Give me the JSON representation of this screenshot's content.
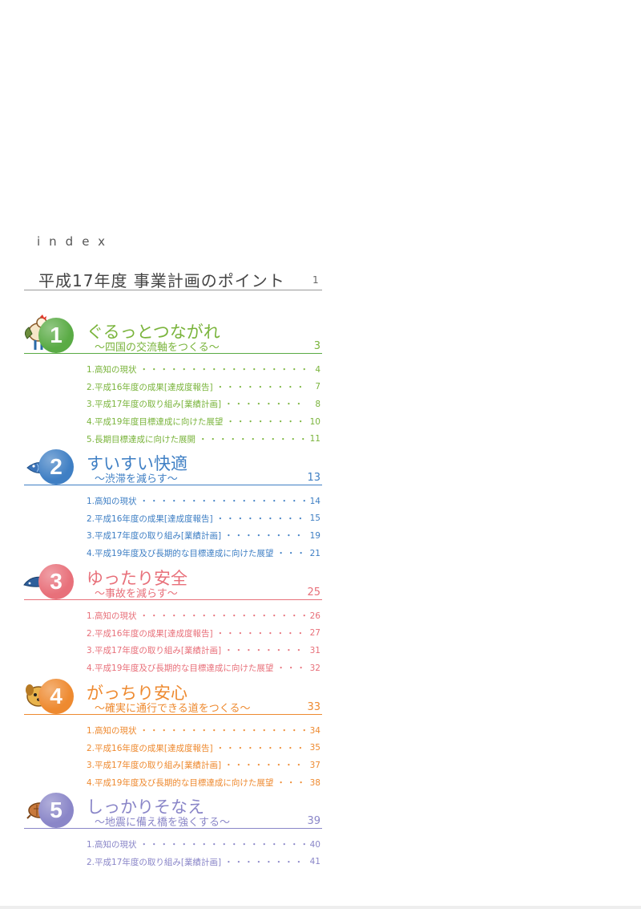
{
  "index_label": "index",
  "main": {
    "title": "平成17年度 事業計画のポイント",
    "page": "1"
  },
  "dots": "・・・・・・・・・・・・・・・・・・・・・・・・・・・・・・・・・・・・・・・・・・・・",
  "sections": [
    {
      "number": "1",
      "title": "ぐるっとつながれ",
      "subtitle": "〜四国の交流軸をつくる〜",
      "page": "3",
      "color": "#5aab45",
      "text_color": "#7ab43c",
      "items": [
        {
          "label": "1.高知の現状",
          "page": "4"
        },
        {
          "label": "2.平成16年度の成果[達成度報告]",
          "page": "7"
        },
        {
          "label": "3.平成17年度の取り組み[業績計画]",
          "page": "8"
        },
        {
          "label": "4.平成19年度目標達成に向けた展望",
          "page": "10"
        },
        {
          "label": "5.長期目標達成に向けた展開",
          "page": "11"
        }
      ]
    },
    {
      "number": "2",
      "title": "すいすい快適",
      "subtitle": "〜渋滞を減らす〜",
      "page": "13",
      "color": "#3f7fc4",
      "text_color": "#3f7fc4",
      "items": [
        {
          "label": "1.高知の現状",
          "page": "14"
        },
        {
          "label": "2.平成16年度の成果[達成度報告]",
          "page": "15"
        },
        {
          "label": "3.平成17年度の取り組み[業績計画]",
          "page": "19"
        },
        {
          "label": "4.平成19年度及び長期的な目標達成に向けた展望",
          "page": "21"
        }
      ]
    },
    {
      "number": "3",
      "title": "ゆったり安全",
      "subtitle": "〜事故を減らす〜",
      "page": "25",
      "color": "#e8707a",
      "text_color": "#e8707a",
      "items": [
        {
          "label": "1.高知の現状",
          "page": "26"
        },
        {
          "label": "2.平成16年度の成果[達成度報告]",
          "page": "27"
        },
        {
          "label": "3.平成17年度の取り組み[業績計画]",
          "page": "31"
        },
        {
          "label": "4.平成19年度及び長期的な目標達成に向けた展望",
          "page": "32"
        }
      ]
    },
    {
      "number": "4",
      "title": "がっちり安心",
      "subtitle": "〜確実に通行できる道をつくる〜",
      "page": "33",
      "color": "#ee8a30",
      "text_color": "#ee8a30",
      "items": [
        {
          "label": "1.高知の現状",
          "page": "34"
        },
        {
          "label": "2.平成16年度の成果[達成度報告]",
          "page": "35"
        },
        {
          "label": "3.平成17年度の取り組み[業績計画]",
          "page": "37"
        },
        {
          "label": "4.平成19年度及び長期的な目標達成に向けた展望",
          "page": "38"
        }
      ]
    },
    {
      "number": "5",
      "title": "しっかりそなえ",
      "subtitle": "〜地震に備え橋を強くする〜",
      "page": "39",
      "color": "#8a86c8",
      "text_color": "#8a86c8",
      "items": [
        {
          "label": "1.高知の現状",
          "page": "40"
        },
        {
          "label": "2.平成17年度の取り組み[業績計画]",
          "page": "41"
        }
      ]
    }
  ]
}
